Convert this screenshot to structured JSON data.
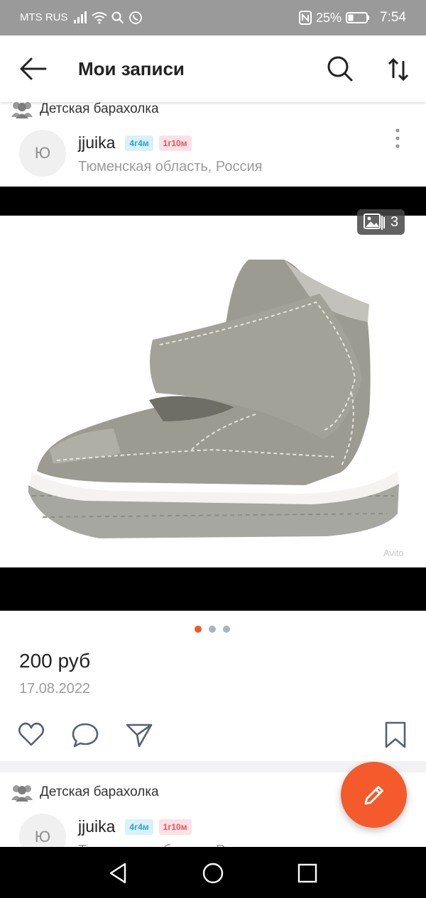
{
  "status_bar": {
    "carrier": "MTS RUS",
    "battery": "25%",
    "time": "7:54"
  },
  "app_bar": {
    "title": "Мои записи"
  },
  "posts": [
    {
      "group": "Детская барахолка",
      "avatar_letter": "Ю",
      "username": "jjuika",
      "badge1": "4г4м",
      "badge2": "1г10м",
      "location": "Тюменская область, Россия",
      "photo_count": "3",
      "watermark": "Avito",
      "price": "200 руб",
      "date": "17.08.2022"
    },
    {
      "group": "Детская барахолка",
      "avatar_letter": "Ю",
      "username": "jjuika",
      "badge1": "4г4м",
      "badge2": "1г10м",
      "location": "Тюменская область, Россия"
    }
  ],
  "carousel": {
    "total": 3,
    "active": 1
  },
  "colors": {
    "accent": "#f45a2c",
    "badge_blue": "#2e9fd2",
    "badge_pink": "#e25568",
    "status_bar": "#9a9a9a"
  },
  "icons": [
    "back-arrow-icon",
    "search-icon",
    "sort-icon",
    "group-icon",
    "more-vertical-icon",
    "image-icon",
    "heart-icon",
    "comment-icon",
    "share-icon",
    "bookmark-icon",
    "edit-icon",
    "nav-back-icon",
    "nav-home-icon",
    "nav-recents-icon"
  ]
}
